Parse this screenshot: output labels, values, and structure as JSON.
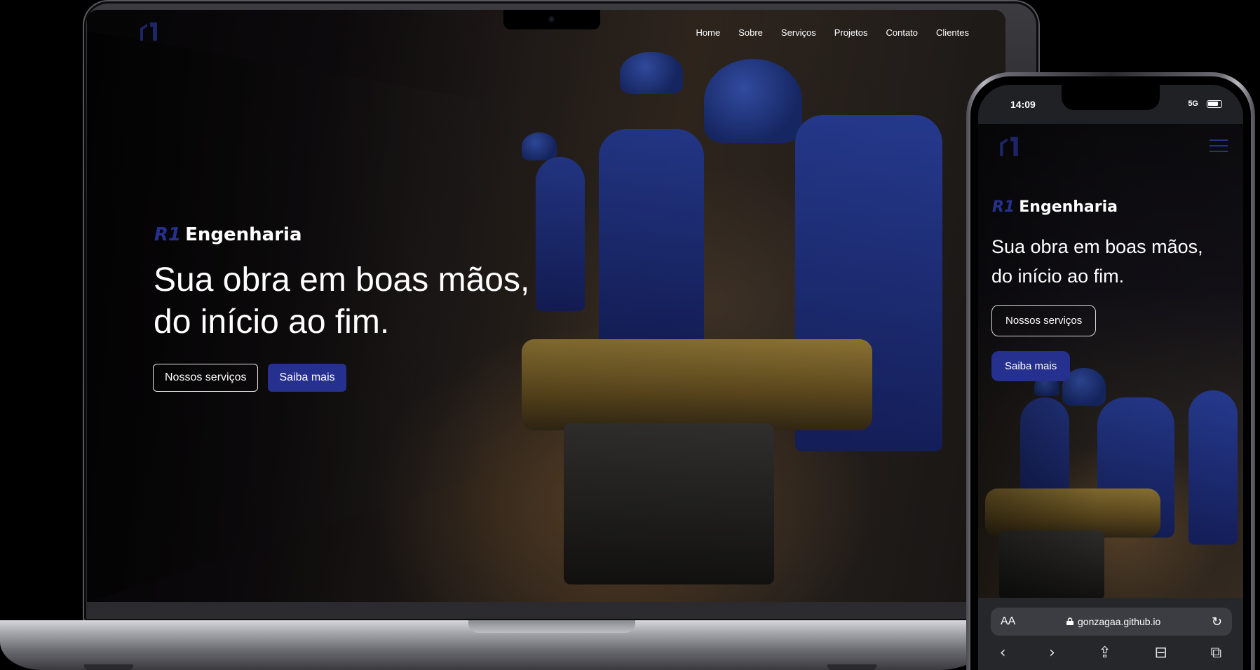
{
  "laptop": {
    "nav": [
      "Home",
      "Sobre",
      "Serviços",
      "Projetos",
      "Contato",
      "Clientes"
    ],
    "hero": {
      "brand_mark": "R1",
      "brand_name": "Engenharia",
      "title_line1": "Sua obra em boas mãos,",
      "title_line2": "do início ao fim.",
      "btn_services": "Nossos serviços",
      "btn_more": "Saiba mais"
    }
  },
  "phone": {
    "status": {
      "time": "14:09",
      "network": "5G"
    },
    "hero": {
      "brand_mark": "R1",
      "brand_name": "Engenharia",
      "title": "Sua obra em boas mãos, do início ao fim.",
      "btn_services": "Nossos serviços",
      "btn_more": "Saiba mais"
    },
    "browser": {
      "aa_label": "AA",
      "url": "gonzagaa.github.io"
    }
  },
  "colors": {
    "brand_blue": "#26318f",
    "nav_text": "#ffffff",
    "accent_amber": "#a88a3e"
  },
  "icons": [
    "logo-icon",
    "menu-icon",
    "lock-icon",
    "reload-icon",
    "back-icon",
    "forward-icon",
    "share-icon",
    "bookmarks-icon",
    "tabs-icon"
  ]
}
